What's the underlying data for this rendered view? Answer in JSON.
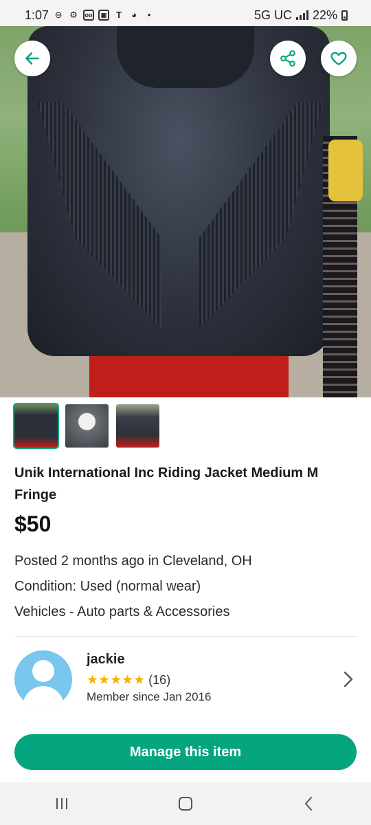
{
  "status_bar": {
    "time": "1:07",
    "network": "5G UC",
    "battery": "22%",
    "icons": [
      "do-not-disturb-icon",
      "gear-icon",
      "voicemail-icon",
      "photo-icon",
      "t-mobile-icon",
      "game-controller-icon",
      "dot-icon"
    ]
  },
  "listing": {
    "title": "Unik International Inc Riding Jacket Medium M Fringe",
    "price": "$50",
    "posted": "Posted 2 months ago in Cleveland, OH",
    "condition": "Condition: Used (normal wear)",
    "category": "Vehicles - Auto parts & Accessories",
    "thumbnails": [
      "jacket-front-thumbnail",
      "jacket-label-thumbnail",
      "jacket-side-thumbnail"
    ]
  },
  "seller": {
    "name": "jackie",
    "stars": "★★★★★",
    "rating_count": "(16)",
    "member_since": "Member since Jan 2016"
  },
  "actions": {
    "manage_label": "Manage this item"
  },
  "colors": {
    "accent": "#05a57f",
    "star": "#f5b400",
    "avatar_bg": "#79c6ee"
  }
}
